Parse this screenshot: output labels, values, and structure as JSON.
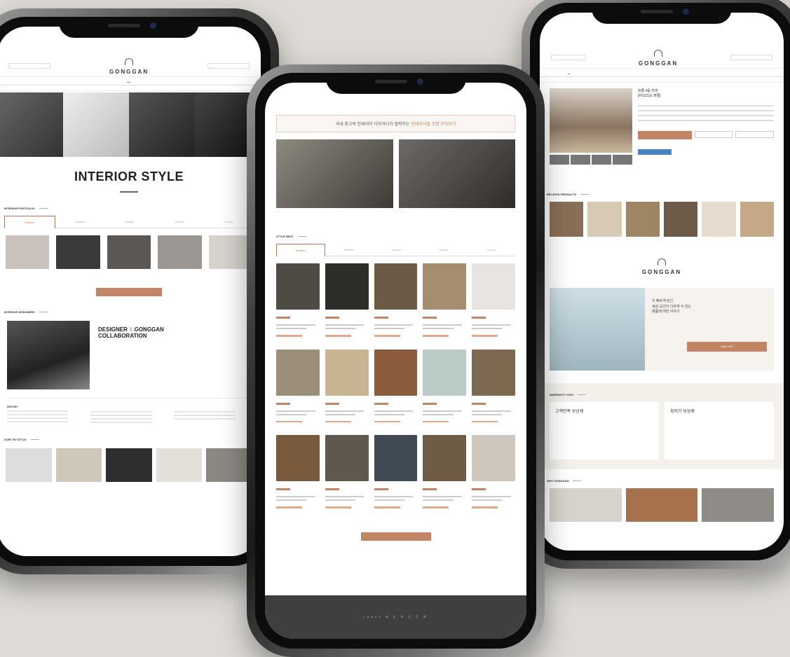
{
  "left_phone": {
    "brand": "GONGGAN",
    "hero_title": "INTERIOR STYLE",
    "portfolio_section": "INTERIOR PORTFOLIO",
    "tabs": [
      "Modern",
      "Natural",
      "Unique",
      "Simple",
      "Luxury"
    ],
    "designers_section": "INTERIOR DESIGNERS",
    "collab_title_1": "DESIGNER",
    "collab_x": "X",
    "collab_title_2": "GONGGAN",
    "collab_title_3": "COLLABORATION",
    "history_label": "HISTORY",
    "sort_section": "SORT BY STYLE"
  },
  "center_phone": {
    "banner_text": "국내 최고의 인테리어 디자이너가 협력하는",
    "banner_highlight": "인테리어별 조명 모아보기",
    "style_best": "STYLE BEST",
    "tabs": [
      "Modern",
      "Natural",
      "Unique",
      "Simple",
      "Luxury"
    ],
    "footer_text": "Lumen 세 상 의 공 간 에"
  },
  "right_phone": {
    "brand": "GONGGAN",
    "product_name_1": "퍼즐 4등 직부",
    "product_name_2": "[PUZZLE 퍼즐]",
    "related_section": "RELATED PRODUCTS",
    "brand_story_1": "이 빠르게 담긴",
    "brand_story_2": "세상 공간이 다르게 수 있는",
    "brand_story_3": "제품에 대한 이야기",
    "more_button": "More Info",
    "warranty_section": "WARRANTY 100%",
    "card_1": "고객만족 보상제",
    "card_2": "최저가 보상제",
    "why_section": "WHY GONGGAN"
  },
  "colors": {
    "accent": "#c18465",
    "background": "#dedbd6"
  }
}
